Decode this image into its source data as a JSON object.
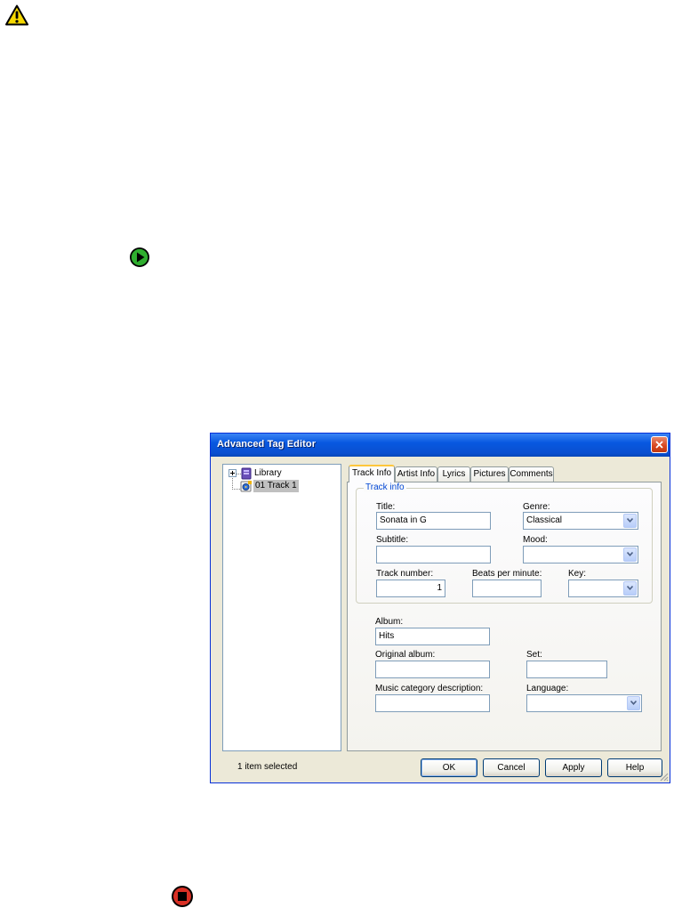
{
  "icons": {
    "warning": "warning-triangle-icon",
    "play": "play-arrow-icon",
    "stop": "stop-square-icon"
  },
  "colors": {
    "titlebar": "#0a4fd0",
    "close_button": "#d7461e",
    "active_tab_accent": "#ffc73c",
    "groupbox_legend": "#0046d5",
    "play_green": "#2fae2f",
    "stop_red": "#d93025",
    "warning_yellow": "#f5d800"
  },
  "dialog": {
    "title": "Advanced Tag Editor",
    "tree": {
      "items": [
        {
          "label": "Library",
          "icon": "library-icon"
        },
        {
          "label": "01 Track 1",
          "icon": "audio-track-icon",
          "selected": true
        }
      ]
    },
    "tabs": [
      {
        "label": "Track Info",
        "active": true
      },
      {
        "label": "Artist Info",
        "active": false
      },
      {
        "label": "Lyrics",
        "active": false
      },
      {
        "label": "Pictures",
        "active": false
      },
      {
        "label": "Comments",
        "active": false
      }
    ],
    "track_info": {
      "group_label": "Track info",
      "title_label": "Title:",
      "title_value": "Sonata in G",
      "genre_label": "Genre:",
      "genre_value": "Classical",
      "subtitle_label": "Subtitle:",
      "subtitle_value": "",
      "mood_label": "Mood:",
      "mood_value": "",
      "track_number_label": "Track number:",
      "track_number_value": "1",
      "bpm_label": "Beats per minute:",
      "bpm_value": "",
      "key_label": "Key:",
      "key_value": ""
    },
    "album_info": {
      "album_label": "Album:",
      "album_value": "Hits",
      "original_album_label": "Original album:",
      "original_album_value": "",
      "set_label": "Set:",
      "set_value": "",
      "music_category_label": "Music category description:",
      "music_category_value": "",
      "language_label": "Language:",
      "language_value": ""
    },
    "status": "1 item selected",
    "buttons": {
      "ok": "OK",
      "cancel": "Cancel",
      "apply": "Apply",
      "help": "Help"
    }
  }
}
